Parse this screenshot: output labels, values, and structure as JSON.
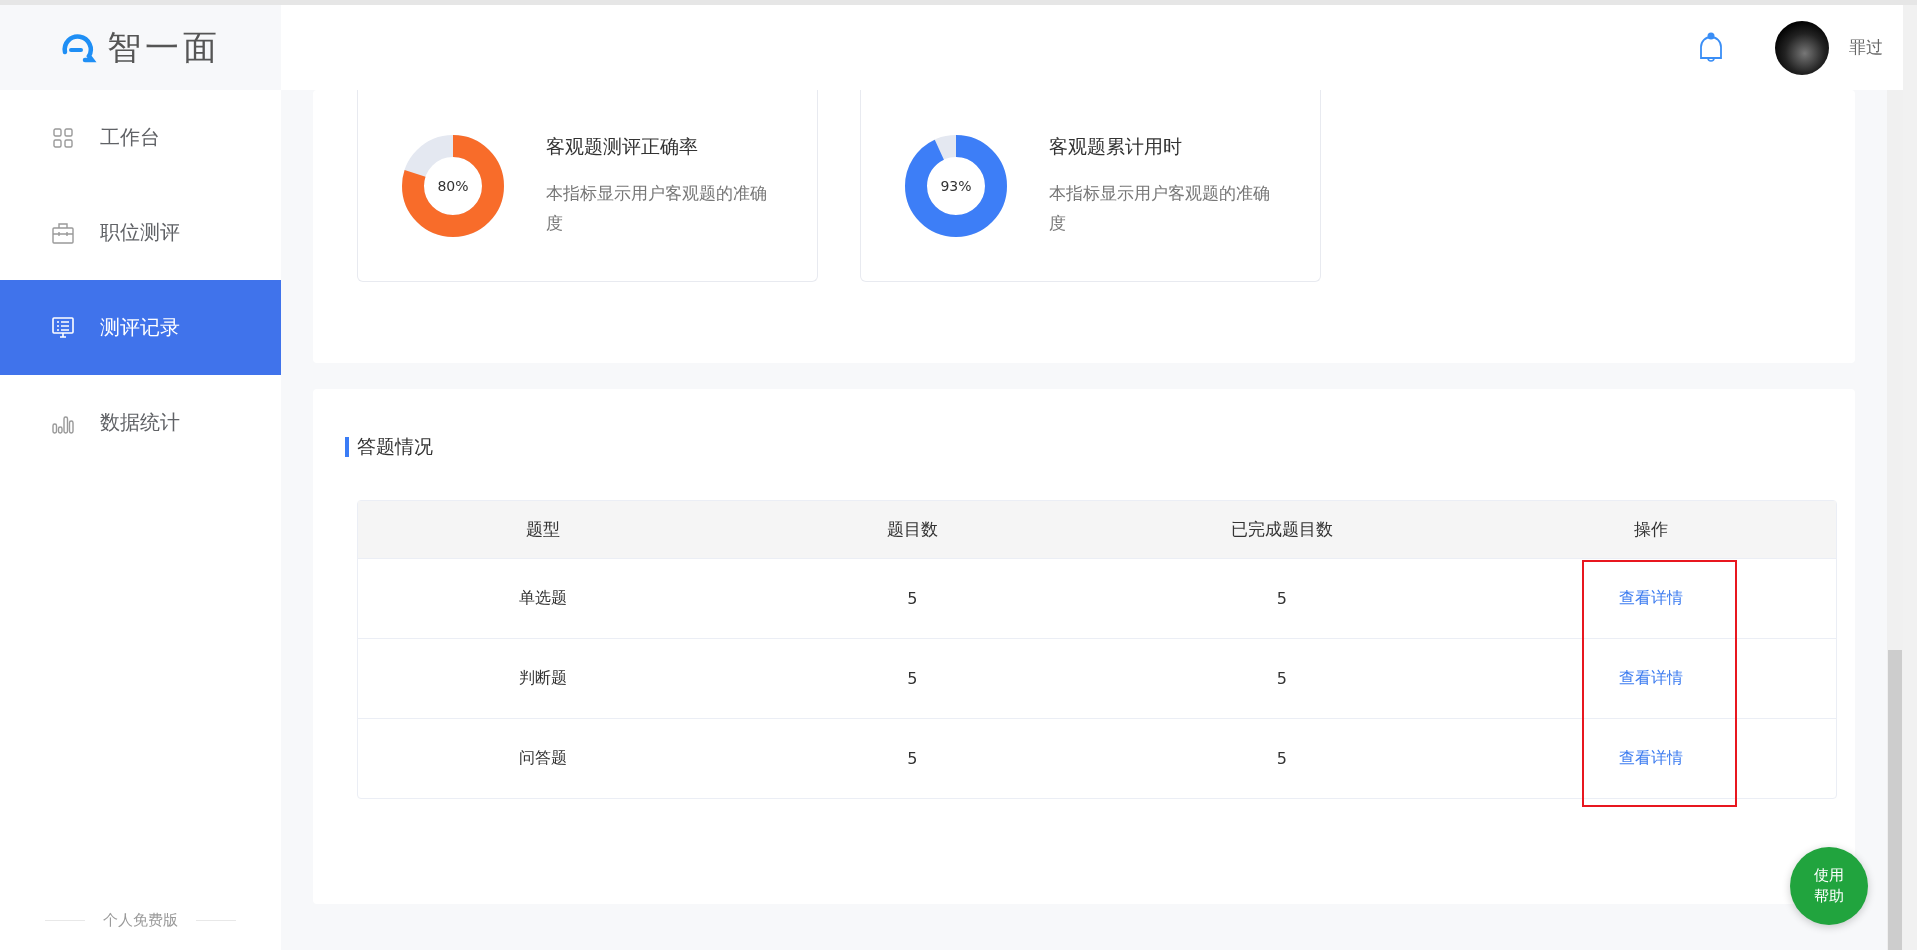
{
  "logo": {
    "text": "智一面"
  },
  "sidebar": {
    "items": [
      {
        "label": "工作台",
        "kind": "grid",
        "selected": false
      },
      {
        "label": "职位测评",
        "kind": "briefcase",
        "selected": false
      },
      {
        "label": "测评记录",
        "kind": "monitor",
        "selected": true
      },
      {
        "label": "数据统计",
        "kind": "bars",
        "selected": false
      }
    ],
    "footer": "个人免费版"
  },
  "header": {
    "user_name": "罪过"
  },
  "metric_cards": [
    {
      "title": "客观题测评正确率",
      "description": "本指标显示用户客观题的准确度",
      "reading": "80%",
      "level": 0.8,
      "color": "#f86c2a"
    },
    {
      "title": "客观题累计用时",
      "description": "本指标显示用户客观题的准确度",
      "reading": "93%",
      "level": 0.93,
      "color": "#3d7ef7"
    }
  ],
  "answers": {
    "title": "答题情况",
    "table": {
      "columns": [
        "题型",
        "题目数",
        "已完成题目数",
        "操作"
      ],
      "rows": [
        {
          "type": "单选题",
          "count": "5",
          "done": "5",
          "action": "查看详情"
        },
        {
          "type": "判断题",
          "count": "5",
          "done": "5",
          "action": "查看详情"
        },
        {
          "type": "问答题",
          "count": "5",
          "done": "5",
          "action": "查看详情"
        }
      ]
    }
  },
  "help_button": {
    "line_1": "使用",
    "line_2": "帮助"
  }
}
